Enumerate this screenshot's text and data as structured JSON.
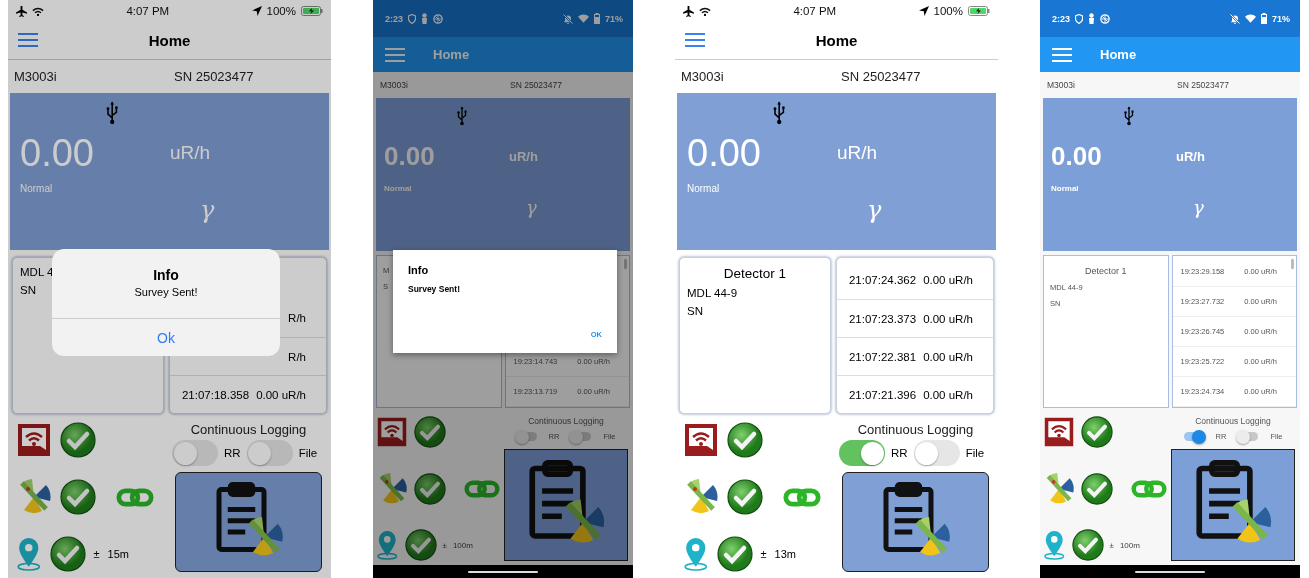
{
  "phones": [
    {
      "kind": "ios",
      "status_bar": {
        "time": "4:07 PM",
        "battery": "100%"
      },
      "title": "Home",
      "device_model": "M3003i",
      "serial": "SN 25023477",
      "reading": {
        "value": "0.00",
        "unit": "uR/h",
        "status": "Normal",
        "radiation_type": "γ"
      },
      "detector": {
        "model": "MDL 4",
        "sn": "SN"
      },
      "log": [
        {
          "reading": "R/h"
        },
        {
          "reading": "R/h"
        },
        {
          "time": "21:07:18.358",
          "reading": "0.00 uR/h"
        }
      ],
      "logging": {
        "label": "Continuous Logging",
        "toggles": [
          {
            "label": "RR",
            "on": false
          },
          {
            "label": "File",
            "on": false
          }
        ]
      },
      "gps": {
        "sign": "±",
        "accuracy": "15m"
      },
      "dialog": {
        "title": "Info",
        "message": "Survey Sent!",
        "button": "Ok"
      }
    },
    {
      "kind": "android",
      "status_bar": {
        "time": "2:23",
        "battery": "71%"
      },
      "title": "Home",
      "device_model": "M3003i",
      "serial": "SN 25023477",
      "reading": {
        "value": "0.00",
        "unit": "uR/h",
        "status": "Normal",
        "radiation_type": "γ"
      },
      "detector": {
        "model": "M",
        "sn": "S"
      },
      "log": [
        {
          "time": "19:23:14.743",
          "reading": "0.00 uR/h"
        },
        {
          "time": "19:23:13.719",
          "reading": "0.00 uR/h"
        }
      ],
      "logging": {
        "label": "Continuous Logging",
        "toggles": [
          {
            "label": "RR",
            "on": false
          },
          {
            "label": "File",
            "on": false
          }
        ]
      },
      "gps": {
        "sign": "±",
        "accuracy": "100m"
      },
      "dialog": {
        "title": "Info",
        "message": "Survey Sent!",
        "button": "OK"
      }
    },
    {
      "kind": "ios",
      "status_bar": {
        "time": "4:07 PM",
        "battery": "100%"
      },
      "title": "Home",
      "device_model": "M3003i",
      "serial": "SN 25023477",
      "reading": {
        "value": "0.00",
        "unit": "uR/h",
        "status": "Normal",
        "radiation_type": "γ"
      },
      "detector": {
        "title": "Detector 1",
        "model": "MDL 44-9",
        "sn": "SN"
      },
      "log": [
        {
          "time": "21:07:24.362",
          "reading": "0.00 uR/h"
        },
        {
          "time": "21:07:23.373",
          "reading": "0.00 uR/h"
        },
        {
          "time": "21:07:22.381",
          "reading": "0.00 uR/h"
        },
        {
          "time": "21:07:21.396",
          "reading": "0.00 uR/h"
        }
      ],
      "logging": {
        "label": "Continuous Logging",
        "toggles": [
          {
            "label": "RR",
            "on": true
          },
          {
            "label": "File",
            "on": false
          }
        ]
      },
      "gps": {
        "sign": "±",
        "accuracy": "13m"
      }
    },
    {
      "kind": "android",
      "status_bar": {
        "time": "2:23",
        "battery": "71%"
      },
      "title": "Home",
      "device_model": "M3003i",
      "serial": "SN 25023477",
      "reading": {
        "value": "0.00",
        "unit": "uR/h",
        "status": "Normal",
        "radiation_type": "γ"
      },
      "detector": {
        "title": "Detector 1",
        "model": "MDL 44-9",
        "sn": "SN"
      },
      "log": [
        {
          "time": "19:23:29.158",
          "reading": "0.00 uR/h"
        },
        {
          "time": "19:23:27.732",
          "reading": "0.00 uR/h"
        },
        {
          "time": "19:23:26.745",
          "reading": "0.00 uR/h"
        },
        {
          "time": "19:23:25.722",
          "reading": "0.00 uR/h"
        },
        {
          "time": "19:23:24.734",
          "reading": "0.00 uR/h"
        }
      ],
      "logging": {
        "label": "Continuous Logging",
        "toggles": [
          {
            "label": "RR",
            "on": true
          },
          {
            "label": "File",
            "on": false
          }
        ]
      },
      "gps": {
        "sign": "±",
        "accuracy": "100m"
      }
    }
  ]
}
